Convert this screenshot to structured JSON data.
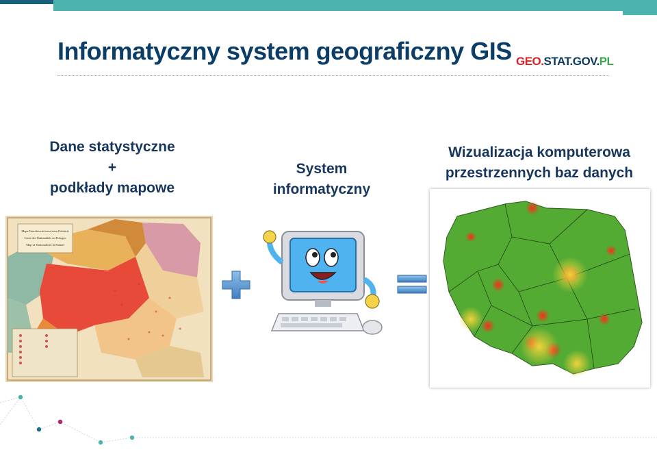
{
  "slide": {
    "title": "Informatyczny system geograficzny GIS",
    "logo": {
      "part1": "GEO.",
      "part2": "STAT.GOV.",
      "part3": "PL"
    },
    "captions": {
      "left": [
        "Dane statystyczne",
        "+",
        "podkłady mapowe"
      ],
      "middle": [
        "System",
        "informatyczny"
      ],
      "right": [
        "Wizualizacja komputerowa",
        "przestrzennych baz danych"
      ]
    },
    "old_map": {
      "titles": [
        "Mapa Narodowościowa ziem Polskich",
        "Carte des Nationalités en Pologne",
        "Map of Nationalities in Poland"
      ]
    }
  },
  "colors": {
    "title": "#0c3d66",
    "accent_teal": "#4db3ae",
    "accent_dark": "#1b6f86",
    "logo_red": "#d9222a",
    "logo_blue": "#0c3d66",
    "logo_green": "#3aa84a"
  },
  "icons": [
    "plus-icon",
    "equals-icon",
    "computer-mascot-icon"
  ]
}
